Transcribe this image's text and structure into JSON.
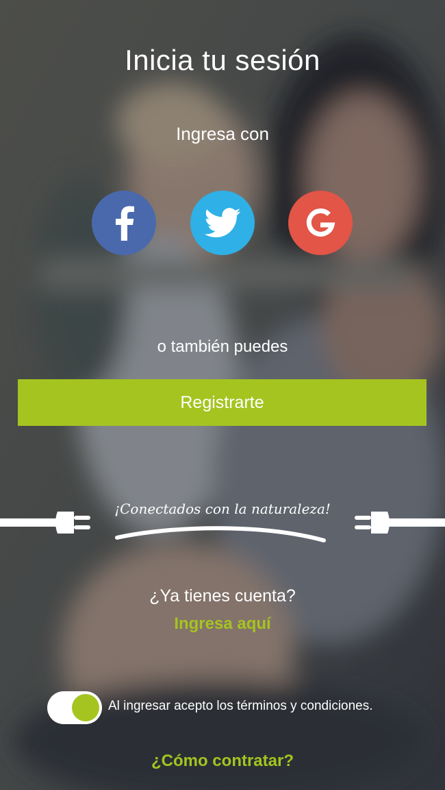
{
  "header": {
    "title": "Inicia tu sesión"
  },
  "social": {
    "prompt": "Ingresa con",
    "buttons": [
      {
        "name": "facebook",
        "icon": "facebook-icon",
        "color": "#4a69ad"
      },
      {
        "name": "twitter",
        "icon": "twitter-bird-icon",
        "color": "#2fb0e6"
      },
      {
        "name": "google",
        "icon": "google-g-icon",
        "color": "#e25547"
      }
    ]
  },
  "register": {
    "prompt": "o también puedes",
    "button_label": "Registrarte"
  },
  "slogan": {
    "text": "¡Conectados con la naturaleza!"
  },
  "login": {
    "question": "¿Ya tienes cuenta?",
    "link_label": "Ingresa aquí"
  },
  "terms": {
    "label": "Al ingresar acepto los términos y condiciones.",
    "accepted": true
  },
  "footer": {
    "link_label": "¿Cómo contratar?"
  },
  "colors": {
    "accent": "#a5c420",
    "overlay": "#3c4048"
  }
}
